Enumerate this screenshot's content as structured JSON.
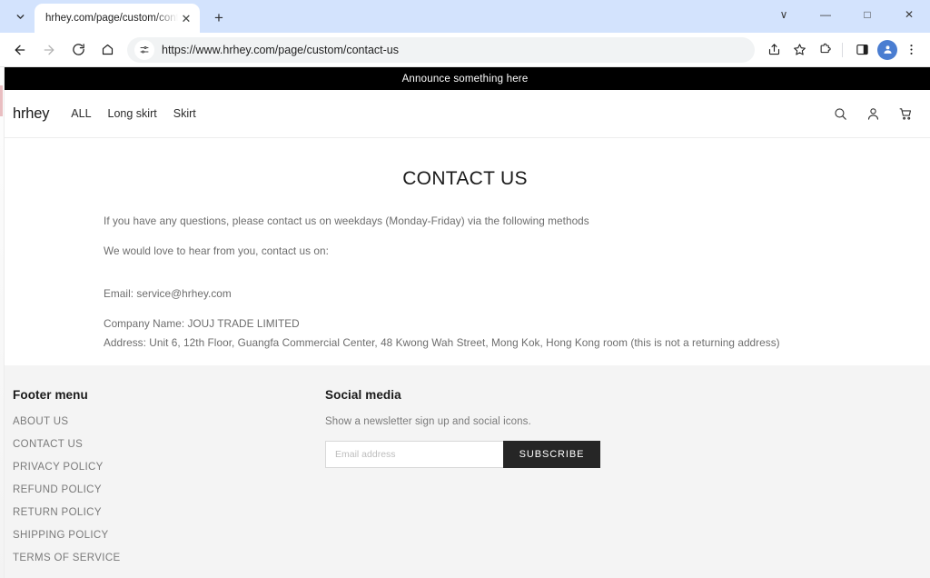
{
  "browser": {
    "tab": {
      "title": "hrhey.com/page/custom/contac",
      "close_label": "✕",
      "search_tabs_icon": "chevron-down-icon"
    },
    "new_tab_label": "+",
    "window_controls": {
      "minimize": "—",
      "maximize": "□",
      "close": "✕",
      "collapse": "∨"
    },
    "omnibox": {
      "url": "https://www.hrhey.com/page/custom/contact-us",
      "site_settings_icon": "tune-icon"
    },
    "nav": {
      "back_icon": "arrow-left-icon",
      "forward_icon": "arrow-right-icon",
      "reload_icon": "reload-icon",
      "home_icon": "home-icon"
    },
    "toolbar_icons": {
      "share": "share-icon",
      "bookmark": "star-icon",
      "extensions": "extensions-icon",
      "side_panel": "side-panel-icon",
      "profile": "profile-avatar-icon",
      "menu": "three-dot-menu-icon"
    }
  },
  "site": {
    "announcement": "Announce something here",
    "logo": "hrhey",
    "nav_links": [
      {
        "label": "ALL"
      },
      {
        "label": "Long skirt"
      },
      {
        "label": "Skirt"
      }
    ],
    "header_icons": [
      {
        "name": "search-icon"
      },
      {
        "name": "account-icon"
      },
      {
        "name": "cart-icon"
      }
    ]
  },
  "main": {
    "title": "CONTACT US",
    "paragraphs": [
      "If you have any questions, please contact us on weekdays (Monday-Friday) via the following methods",
      "We would love to hear from you, contact us on:",
      "Email: service@hrhey.com"
    ],
    "company_name": "Company Name: JOUJ TRADE LIMITED",
    "address": "Address: Unit 6, 12th Floor, Guangfa Commercial Center, 48 Kwong Wah Street, Mong Kok, Hong Kong room (this is not a returning address)"
  },
  "footer": {
    "menu_heading": "Footer menu",
    "menu_links": [
      {
        "label": "ABOUT US"
      },
      {
        "label": "CONTACT US"
      },
      {
        "label": "PRIVACY POLICY"
      },
      {
        "label": "REFUND POLICY"
      },
      {
        "label": "RETURN POLICY"
      },
      {
        "label": "SHIPPING POLICY"
      },
      {
        "label": "TERMS OF SERVICE"
      }
    ],
    "social_heading": "Social media",
    "social_note": "Show a newsletter sign up and social icons.",
    "email_placeholder": "Email address",
    "email_value": "",
    "subscribe_label": "SUBSCRIBE"
  },
  "colors": {
    "announcement_bg": "#000000",
    "footer_bg": "#f4f4f4",
    "subscribe_bg": "#262626",
    "tabstrip_bg": "#d3e3fd",
    "profile_accent": "#4a7dd1"
  }
}
